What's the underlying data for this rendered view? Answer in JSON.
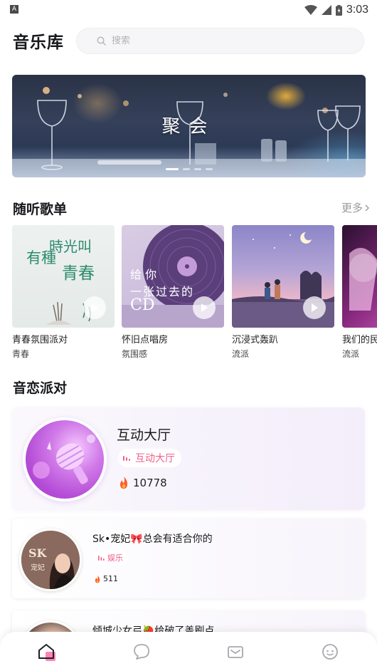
{
  "status_bar": {
    "left_badge": "A",
    "time": "3:03"
  },
  "header": {
    "title": "音乐库",
    "search_placeholder": "搜索"
  },
  "banner": {
    "title": "聚会",
    "slide_count": 4,
    "active_slide": 1
  },
  "playlists_section": {
    "title": "随听歌单",
    "more_label": "更多",
    "items": [
      {
        "name": "青春氛围派对",
        "tag": "青春",
        "cover_text_1": "時光叫",
        "cover_text_2": "有種",
        "cover_text_3": "青春"
      },
      {
        "name": "怀旧点唱房",
        "tag": "氛围感",
        "cover_text_1": "给 你",
        "cover_text_2": "一张过去的",
        "cover_text_3": "CD"
      },
      {
        "name": "沉浸式轰趴",
        "tag": "流派"
      },
      {
        "name": "我们的民",
        "tag": "流派"
      }
    ]
  },
  "party_section": {
    "title": "音恋派对",
    "featured": {
      "name": "互动大厅",
      "tag": "互动大厅",
      "hot": "10778"
    },
    "rooms": [
      {
        "title": "Sk•宠妃🎀总会有适合你的",
        "tag": "娱乐",
        "hot": "511",
        "avatar_text_1": "SK",
        "avatar_text_2": "宠妃"
      },
      {
        "title": "倾城少女弓🍓给破了盖刷点"
      }
    ]
  },
  "colors": {
    "accent_pink": "#f0608a",
    "nav_active": "#ff6fa6",
    "party_purple": "#b44bd6"
  },
  "bottom_nav": {
    "items": [
      "home-icon",
      "message-icon",
      "mail-icon",
      "profile-icon"
    ],
    "active": "home-icon"
  }
}
